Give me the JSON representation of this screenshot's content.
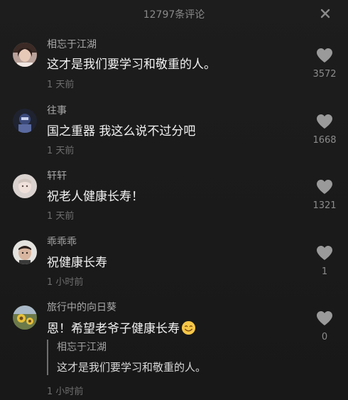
{
  "header": {
    "title": "12797条评论"
  },
  "comments": [
    {
      "username": "相忘于江湖",
      "text": "这才是我们要学习和敬重的人。",
      "time": "1 天前",
      "likes": "3572"
    },
    {
      "username": "往事",
      "text": "国之重器  我这么说不过分吧",
      "time": "1 天前",
      "likes": "1668"
    },
    {
      "username": "轩轩",
      "text": "祝老人健康长寿！",
      "time": "1 天前",
      "likes": "1321"
    },
    {
      "username": "乖乖乖",
      "text": "祝健康长寿",
      "time": "1 小时前",
      "likes": "1"
    },
    {
      "username": "旅行中的向日葵",
      "text": "恩！希望老爷子健康长寿",
      "time": "1 小时前",
      "likes": "0",
      "quote": {
        "username": "相忘于江湖",
        "text": "这才是我们要学习和敬重的人。"
      }
    }
  ],
  "icons": {
    "close": "close-icon",
    "like": "heart-icon",
    "emoji": "smiley-emoji"
  },
  "colors": {
    "background": "#1a1a1a",
    "text_primary": "#f2f2f2",
    "text_secondary": "#a8a8a8",
    "text_muted": "#6e6e6e",
    "like_icon": "#9a9a9a",
    "emoji_face": "#f7c748"
  }
}
